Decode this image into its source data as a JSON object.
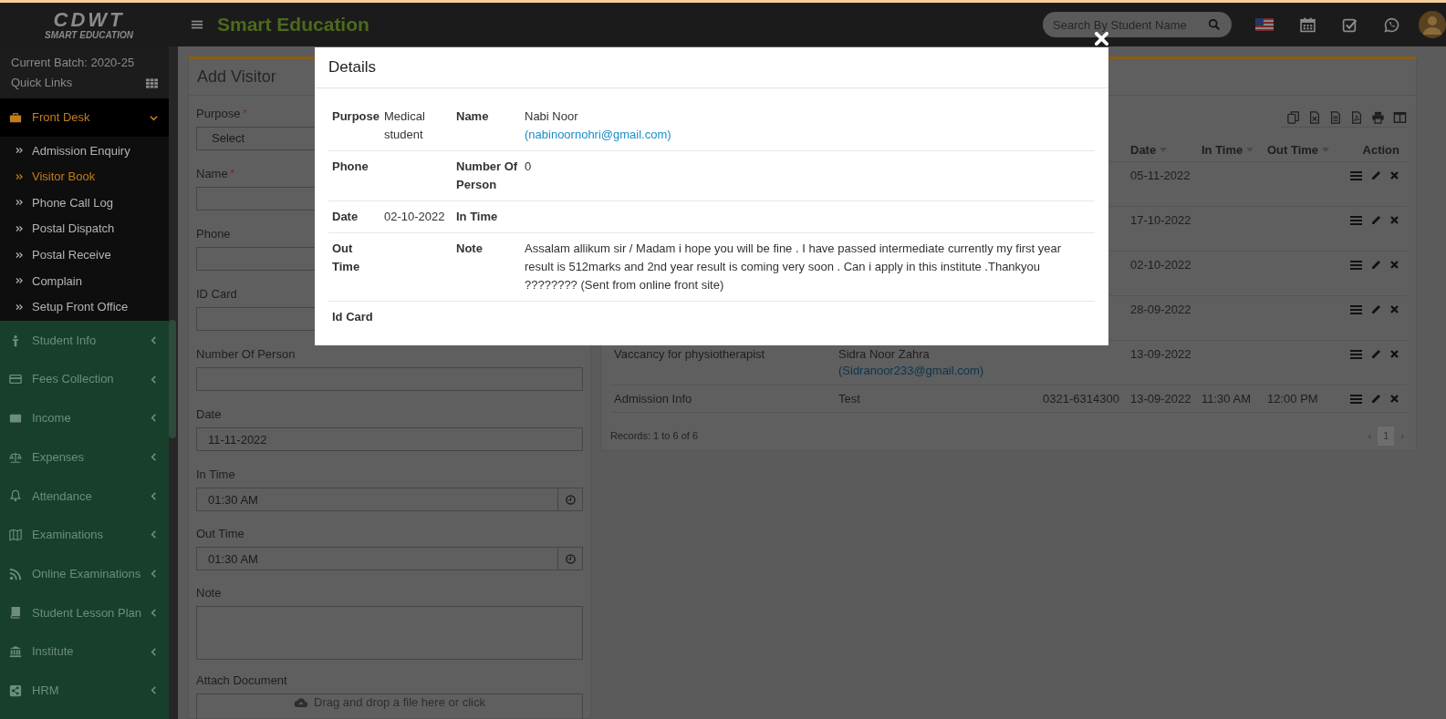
{
  "header": {
    "logo_title": "CDWT",
    "logo_subtitle": "SMART EDUCATION",
    "app_title": "Smart Education",
    "search": {
      "placeholder": "Search By Student Name"
    }
  },
  "sidebar": {
    "batch": "Current Batch: 2020-25",
    "quick_links": "Quick Links",
    "items": [
      {
        "label": "Front Desk",
        "expanded": true,
        "children": [
          {
            "label": "Admission Enquiry",
            "selected": false
          },
          {
            "label": "Visitor Book",
            "selected": true
          },
          {
            "label": "Phone Call Log",
            "selected": false
          },
          {
            "label": "Postal Dispatch",
            "selected": false
          },
          {
            "label": "Postal Receive",
            "selected": false
          },
          {
            "label": "Complain",
            "selected": false
          },
          {
            "label": "Setup Front Office",
            "selected": false
          }
        ]
      },
      {
        "label": "Student Info",
        "expanded": false
      },
      {
        "label": "Fees Collection",
        "expanded": false
      },
      {
        "label": "Income",
        "expanded": false
      },
      {
        "label": "Expenses",
        "expanded": false
      },
      {
        "label": "Attendance",
        "expanded": false
      },
      {
        "label": "Examinations",
        "expanded": false
      },
      {
        "label": "Online Examinations",
        "expanded": false
      },
      {
        "label": "Student Lesson Plan",
        "expanded": false
      },
      {
        "label": "Institute",
        "expanded": false
      },
      {
        "label": "HRM",
        "expanded": false
      }
    ]
  },
  "form": {
    "title": "Add Visitor",
    "fields": [
      {
        "label": "Purpose",
        "required_mark": "*",
        "kind": "select",
        "value": "Select"
      },
      {
        "label": "Name",
        "required_mark": "*",
        "kind": "text"
      },
      {
        "label": "Phone",
        "kind": "text"
      },
      {
        "label": "ID Card",
        "kind": "text"
      },
      {
        "label": "Number Of Person",
        "kind": "text"
      },
      {
        "label": "Date",
        "kind": "text",
        "value": "11-11-2022"
      },
      {
        "label": "In Time",
        "kind": "time",
        "value": "01:30 AM"
      },
      {
        "label": "Out Time",
        "kind": "time",
        "value": "01:30 AM"
      },
      {
        "label": "Note",
        "kind": "textarea"
      },
      {
        "label": "Attach Document",
        "kind": "file",
        "hint": "Drag and drop a file here or click"
      }
    ]
  },
  "visitor_table": {
    "columns": [
      {
        "label": "Date",
        "sortable": true
      },
      {
        "label": "In Time",
        "sortable": true
      },
      {
        "label": "Out Time",
        "sortable": true
      },
      {
        "label": "Action",
        "sortable": false
      }
    ],
    "rows": [
      {
        "date": "05-11-2022"
      },
      {
        "date": "17-10-2022"
      },
      {
        "date": "02-10-2022"
      },
      {
        "date": "28-09-2022"
      },
      {
        "purpose": "Vaccancy for physiotherapist",
        "name": "Sidra Noor Zahra",
        "email": "(Sidranoor233@gmail.com)",
        "date": "13-09-2022"
      },
      {
        "purpose": "Admission Info",
        "name": "Test",
        "phone": "0321-6314300",
        "date": "13-09-2022",
        "in_time": "11:30 AM",
        "out_time": "12:00 PM"
      }
    ],
    "records": "Records: 1 to 6 of 6",
    "pagination": {
      "prev": "‹",
      "next": "›",
      "pages": [
        {
          "label": "1",
          "selected": true
        }
      ]
    }
  },
  "modal": {
    "title": "Details",
    "rows": [
      [
        {
          "label": "Purpose",
          "value": "Medical student"
        },
        {
          "label": "Name",
          "value": "Nabi Noor",
          "link": "(nabinoornohri@gmail.com)"
        }
      ],
      [
        {
          "label": "Phone"
        },
        {
          "label": "Number Of Person",
          "value": "0"
        }
      ],
      [
        {
          "label": "Date",
          "value": "02-10-2022"
        },
        {
          "label": "In Time"
        }
      ],
      [
        {
          "label": "Out Time"
        },
        {
          "label": "Note",
          "value": "Assalam allikum sir / Madam i hope you will be fine . I have passed intermediate currently my first year result is 512marks and 2nd year result is coming very soon . Can i apply in this institute .Thankyou ???????? (Sent from online front site)"
        }
      ],
      [
        {
          "label": "Id Card"
        }
      ]
    ]
  }
}
